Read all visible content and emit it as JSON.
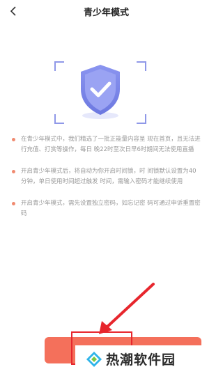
{
  "header": {
    "back_icon": "chevron-left-icon",
    "title": "青少年模式"
  },
  "hero": {
    "icon": "shield-check-icon",
    "accent": "#7b86e6"
  },
  "info_items": [
    {
      "text": "在青少年模式中，我们精选了一批正能量内容呈 现在首页，且无法进行充值、打赏等操作，每日 晚22时至次日早6时期间无法使用直播"
    },
    {
      "text": "开启青少年模式后，将自动为你开启时间锁，时 间锁默认设置为40分钟，单日使用时间超过触发 时间，需输入密码才能继续使用"
    },
    {
      "text": "开启青少年模式，需先设置独立密码，如忘记密 码可通过申诉重置密码"
    }
  ],
  "action_button": {
    "color": "#f4705b"
  },
  "annotation": {
    "color": "#e7262d"
  },
  "watermark": {
    "text": "热潮软件园",
    "icon": "diamond-logo-icon"
  }
}
